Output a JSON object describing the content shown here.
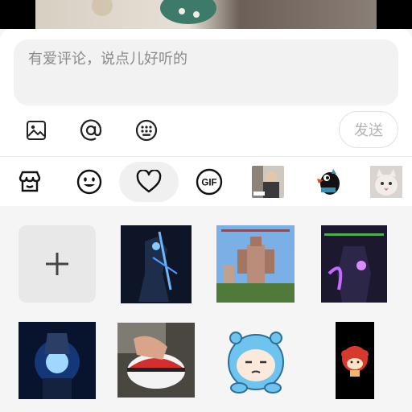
{
  "comment": {
    "placeholder": "有爱评论，说点儿好听的",
    "send_label": "发送"
  },
  "toolbar": {
    "icons": [
      "image-icon",
      "at-mention-icon",
      "emoji-keyboard-icon"
    ]
  },
  "emoji_tabs": [
    {
      "name": "sticker-store-icon",
      "active": false
    },
    {
      "name": "smiley-icon",
      "active": false
    },
    {
      "name": "heart-favorites-icon",
      "active": true
    },
    {
      "name": "gif-icon",
      "active": false
    },
    {
      "name": "sticker-pack-man-thumb",
      "active": false
    },
    {
      "name": "sticker-pack-bird-thumb",
      "active": false
    },
    {
      "name": "sticker-pack-cat-thumb",
      "active": false
    }
  ],
  "gif_badge": "GIF",
  "stickers": [
    {
      "name": "add-sticker"
    },
    {
      "name": "sticker-dark-warrior"
    },
    {
      "name": "sticker-giant-robot"
    },
    {
      "name": "sticker-purple-mech"
    },
    {
      "name": "sticker-glowing-orb"
    },
    {
      "name": "sticker-hand-pokeball"
    },
    {
      "name": "sticker-blue-cat-bear"
    },
    {
      "name": "sticker-red-mushroom"
    }
  ],
  "colors": {
    "accent_gray": "#b3b3b3",
    "sheet_bg": "#ffffff",
    "panel_bg": "#f5f5f5"
  }
}
